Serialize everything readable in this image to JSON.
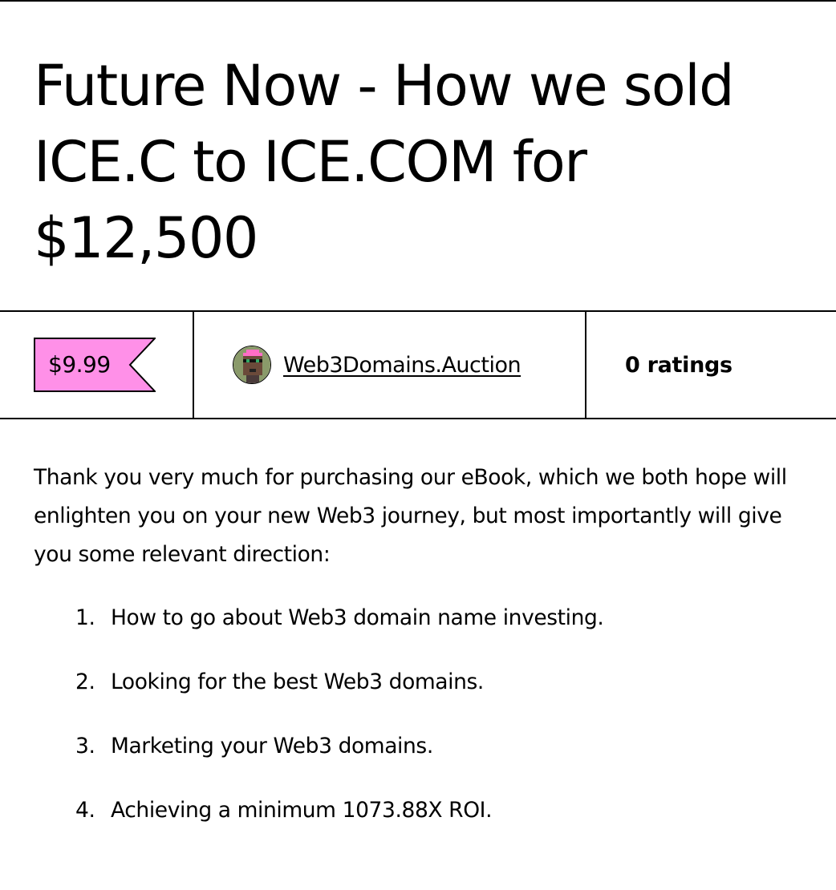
{
  "product": {
    "title": "Future Now - How we sold ICE.C to ICE.COM for $12,500",
    "price": "$9.99",
    "author": "Web3Domains.Auction",
    "ratings": "0 ratings"
  },
  "colors": {
    "price_tag_fill": "#FF90E8",
    "text": "#000000",
    "background": "#FFFFFF"
  },
  "description": {
    "intro": "Thank you very much for purchasing our eBook, which we both hope will enlighten you on your new Web3 journey, but most importantly will give you some relevant direction:",
    "items": [
      {
        "num": "1.",
        "text": "How to go about Web3 domain name investing."
      },
      {
        "num": "2.",
        "text": "Looking for the best Web3 domains."
      },
      {
        "num": "3.",
        "text": "Marketing your Web3 domains."
      },
      {
        "num": "4.",
        "text": "Achieving a minimum 1073.88X ROI."
      }
    ]
  }
}
